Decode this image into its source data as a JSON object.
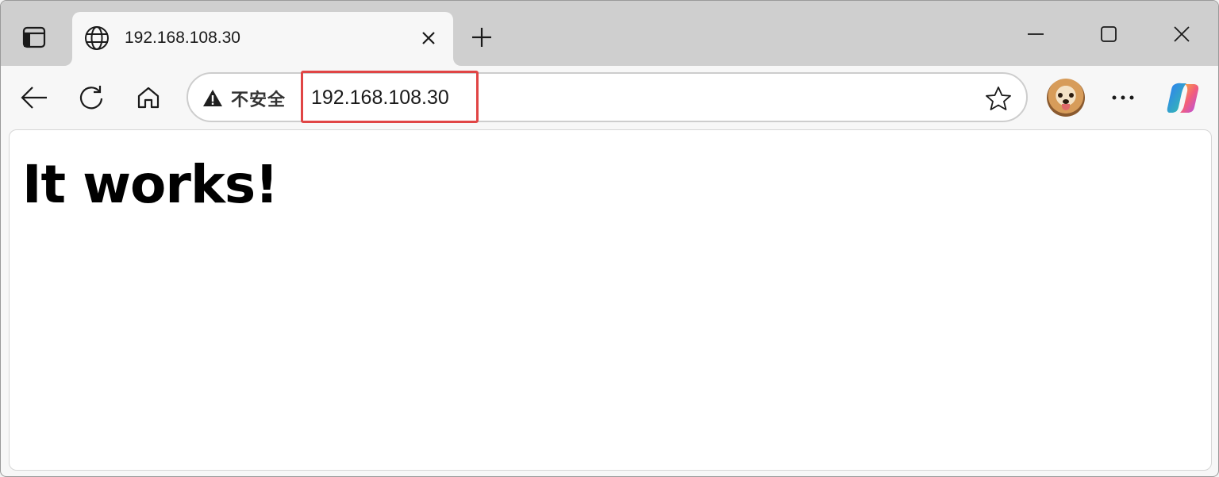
{
  "tab": {
    "title": "192.168.108.30"
  },
  "addressbar": {
    "security_label": "不安全",
    "url": "192.168.108.30"
  },
  "page": {
    "heading": "It works!"
  },
  "icons": {
    "sidebar": "sidebar-toggle-icon",
    "tab_favicon": "globe-icon",
    "tab_close": "close-icon",
    "new_tab": "plus-icon",
    "minimize": "minimize-icon",
    "maximize": "maximize-icon",
    "close_window": "close-icon",
    "back": "back-arrow-icon",
    "refresh": "refresh-icon",
    "home": "home-icon",
    "warning": "warning-icon",
    "favorite": "star-icon",
    "more": "more-icon",
    "copilot": "copilot-icon"
  },
  "colors": {
    "highlight_border": "#e04545",
    "tabstrip_bg": "#cfcfcf",
    "toolbar_bg": "#f7f7f7"
  }
}
